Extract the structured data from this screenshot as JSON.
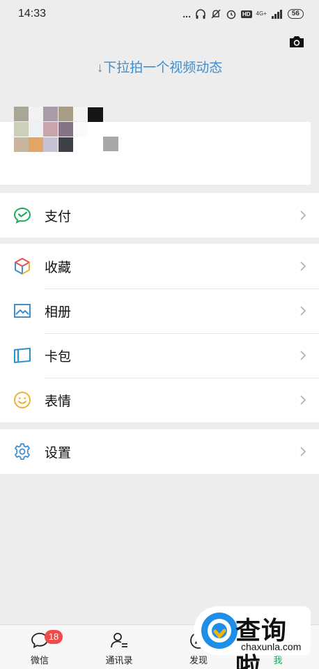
{
  "status_bar": {
    "time": "14:33",
    "dots": "...",
    "network": "4G+",
    "hd": "HD",
    "battery": "56"
  },
  "header": {
    "pull_hint": "↓下拉拍一个视频动态",
    "camera_icon": "camera-icon"
  },
  "menu": {
    "pay": {
      "label": "支付",
      "icon": "wechat-pay-icon",
      "color": "#1aad5b"
    },
    "favorites": {
      "label": "收藏",
      "icon": "cube-icon"
    },
    "album": {
      "label": "相册",
      "icon": "picture-icon",
      "color": "#3d8fd0"
    },
    "cards": {
      "label": "卡包",
      "icon": "card-icon",
      "color": "#2b93c9"
    },
    "stickers": {
      "label": "表情",
      "icon": "smiley-icon",
      "color": "#f0b030"
    },
    "settings": {
      "label": "设置",
      "icon": "gear-icon",
      "color": "#3d8fd0"
    }
  },
  "tabbar": {
    "chats": {
      "label": "微信",
      "badge": "18"
    },
    "contacts": {
      "label": "通讯录"
    },
    "discover": {
      "label": "发现"
    },
    "me": {
      "label": "我",
      "color": "#1aad5b"
    }
  },
  "watermark": {
    "title": "查询啦",
    "subtitle": "chaxunla.com"
  },
  "colors": {
    "background": "#ededed",
    "accent_blue": "#3e8ed0",
    "badge_red": "#f04a4a"
  }
}
